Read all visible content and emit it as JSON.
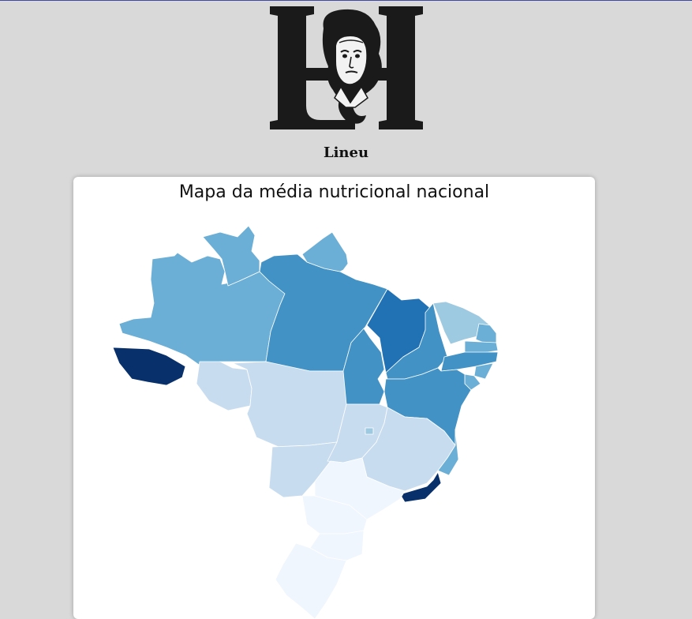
{
  "brand": {
    "name": "Lineu",
    "logo_icon": "lineu-portrait-logo-icon"
  },
  "map_card": {
    "title": "Mapa da média nutricional nacional",
    "color_scale": [
      "#eff6fd",
      "#c8dcf0",
      "#9ecae1",
      "#6baed6",
      "#4292c6",
      "#2171b5",
      "#08519c",
      "#08306b"
    ]
  },
  "map": {
    "type": "choropleth",
    "region": "Brasil",
    "states": [
      {
        "uf": "AC",
        "level": 7
      },
      {
        "uf": "AM",
        "level": 3
      },
      {
        "uf": "RR",
        "level": 3
      },
      {
        "uf": "PA",
        "level": 4
      },
      {
        "uf": "AP",
        "level": 3
      },
      {
        "uf": "TO",
        "level": 4
      },
      {
        "uf": "MA",
        "level": 5
      },
      {
        "uf": "PI",
        "level": 4
      },
      {
        "uf": "CE",
        "level": 2
      },
      {
        "uf": "RN",
        "level": 3
      },
      {
        "uf": "PB",
        "level": 3
      },
      {
        "uf": "PE",
        "level": 4
      },
      {
        "uf": "AL",
        "level": 3
      },
      {
        "uf": "SE",
        "level": 3
      },
      {
        "uf": "BA",
        "level": 4
      },
      {
        "uf": "RO",
        "level": 1
      },
      {
        "uf": "MT",
        "level": 1
      },
      {
        "uf": "MS",
        "level": 1
      },
      {
        "uf": "GO",
        "level": 1
      },
      {
        "uf": "DF",
        "level": 2
      },
      {
        "uf": "MG",
        "level": 1
      },
      {
        "uf": "ES",
        "level": 3
      },
      {
        "uf": "RJ",
        "level": 7
      },
      {
        "uf": "SP",
        "level": 0
      },
      {
        "uf": "PR",
        "level": 0
      },
      {
        "uf": "SC",
        "level": 0
      },
      {
        "uf": "RS",
        "level": 0
      }
    ]
  }
}
